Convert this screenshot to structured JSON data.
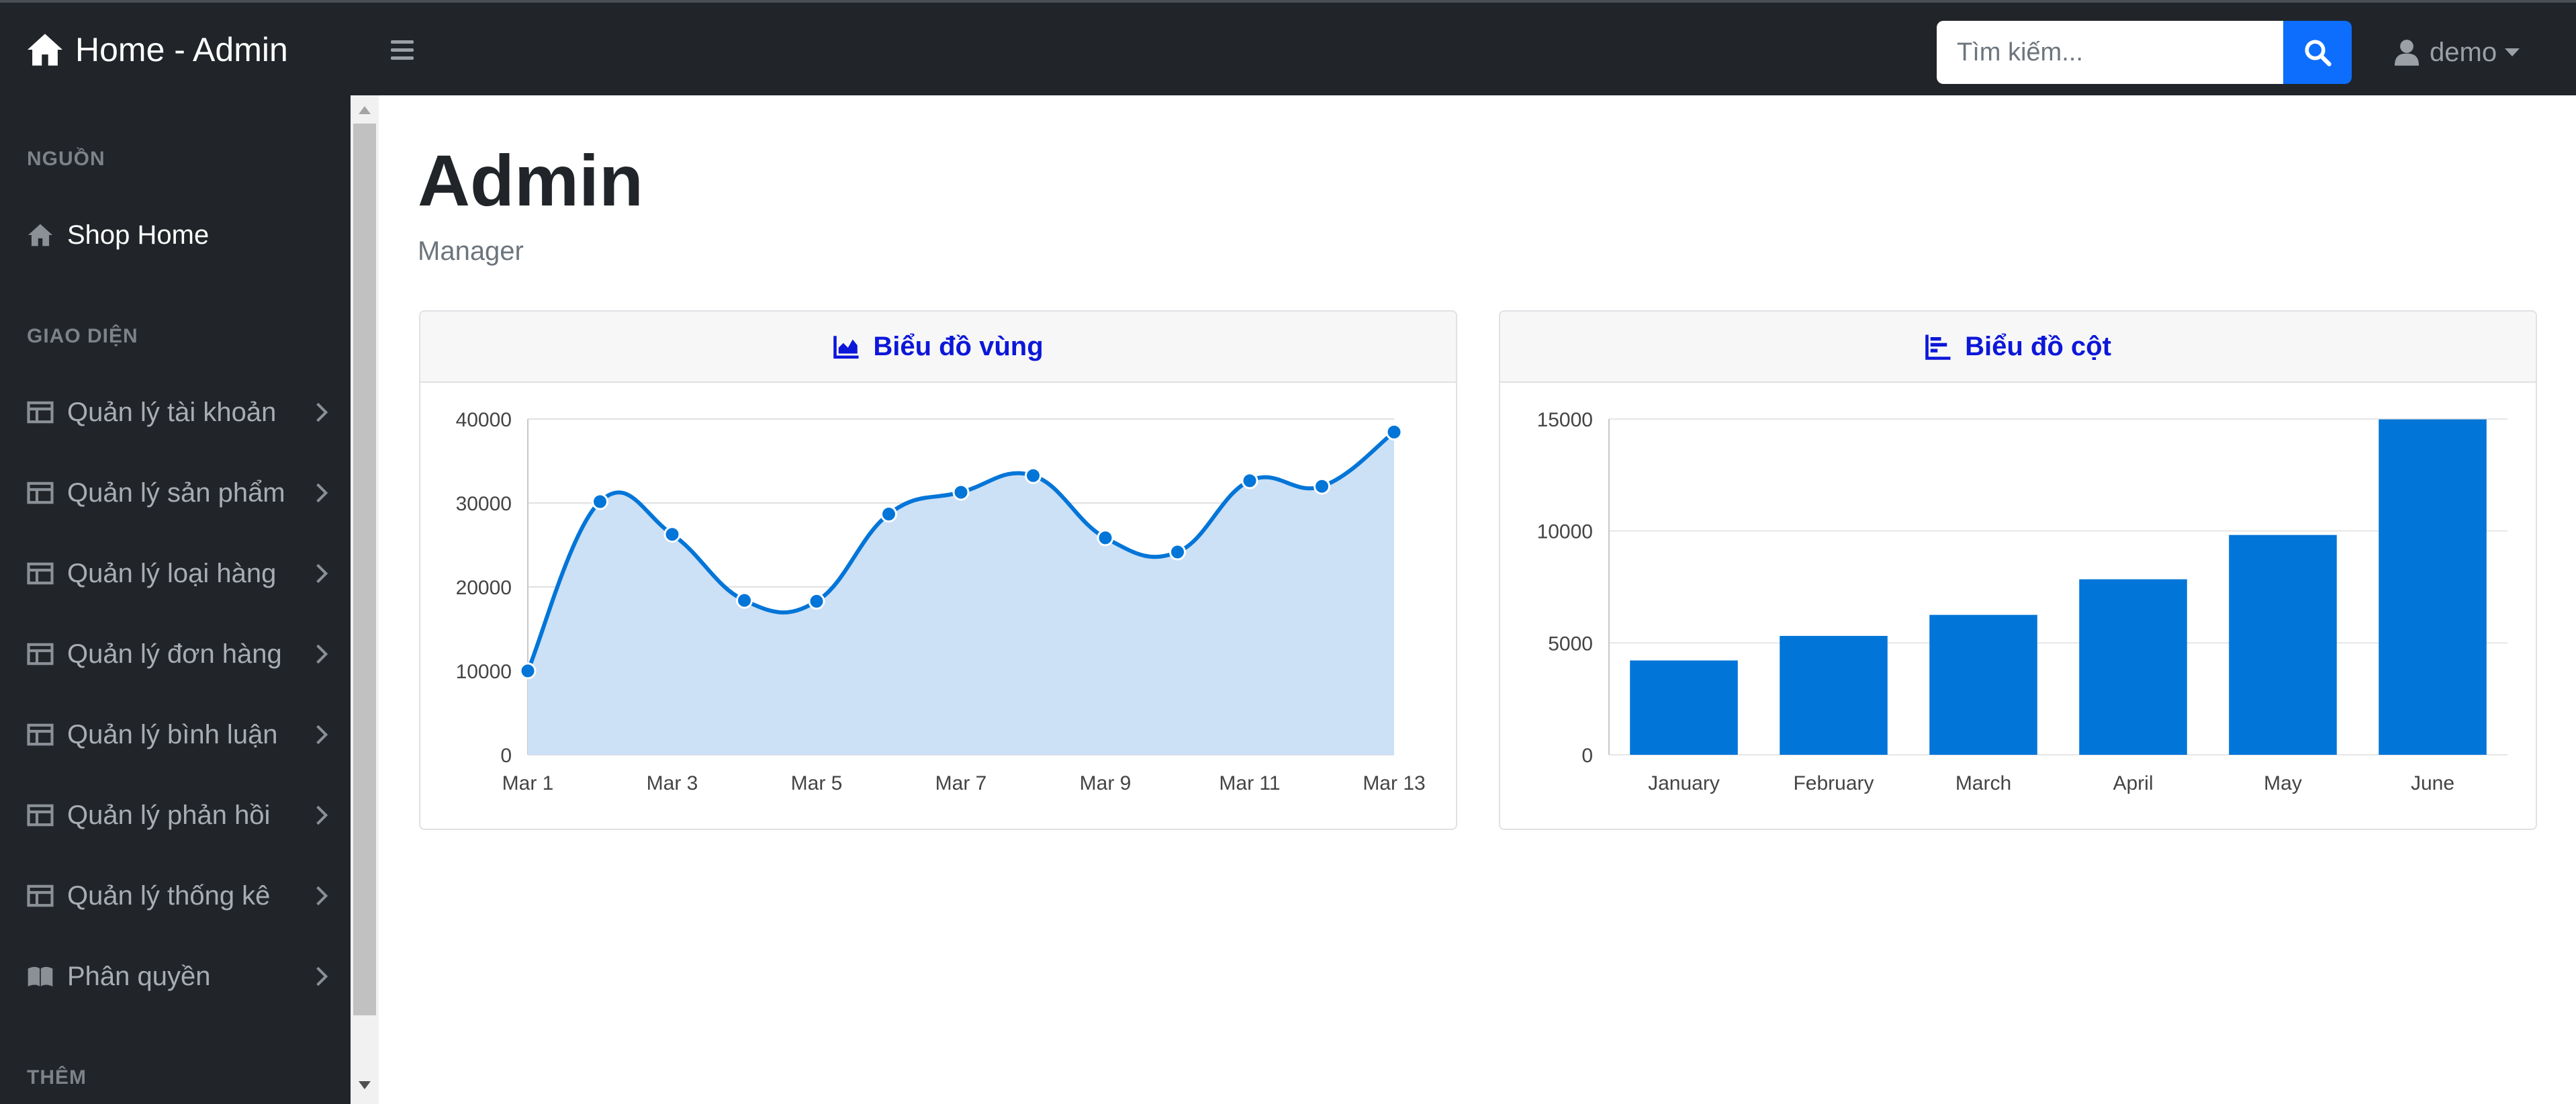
{
  "app": {
    "brand_title": "Home - Admin"
  },
  "search": {
    "placeholder": "Tìm kiếm..."
  },
  "user": {
    "name": "demo"
  },
  "sidebar": {
    "sections": [
      {
        "heading": "NGUỒN"
      },
      {
        "heading": "GIAO DIỆN"
      },
      {
        "heading": "THÊM"
      }
    ],
    "items": [
      {
        "label": "Shop Home",
        "icon": "home-icon"
      },
      {
        "label": "Quản lý tài khoản",
        "icon": "table-icon"
      },
      {
        "label": "Quản lý sản phẩm",
        "icon": "table-icon"
      },
      {
        "label": "Quản lý loại hàng",
        "icon": "table-icon"
      },
      {
        "label": "Quản lý đơn hàng",
        "icon": "table-icon"
      },
      {
        "label": "Quản lý bình luận",
        "icon": "table-icon"
      },
      {
        "label": "Quản lý phản hồi",
        "icon": "table-icon"
      },
      {
        "label": "Quản lý thống kê",
        "icon": "table-icon"
      },
      {
        "label": "Phân quyền",
        "icon": "book-icon"
      }
    ]
  },
  "main": {
    "title": "Admin",
    "subtitle": "Manager"
  },
  "colors": {
    "accent": "#0275d8",
    "area_fill": "#cce0f6",
    "header_text": "#0c17d9",
    "sidebar_bg": "#212529"
  },
  "cards": [
    {
      "title": "Biểu đồ vùng",
      "icon": "area-chart-icon"
    },
    {
      "title": "Biểu đồ cột",
      "icon": "bar-chart-icon"
    }
  ],
  "chart_data": [
    {
      "type": "area",
      "x": [
        "Mar 1",
        "Mar 2",
        "Mar 3",
        "Mar 4",
        "Mar 5",
        "Mar 6",
        "Mar 7",
        "Mar 8",
        "Mar 9",
        "Mar 10",
        "Mar 11",
        "Mar 12",
        "Mar 13"
      ],
      "tick_labels": [
        "Mar 1",
        "Mar 3",
        "Mar 5",
        "Mar 7",
        "Mar 9",
        "Mar 11",
        "Mar 13"
      ],
      "values": [
        10000,
        30162,
        26263,
        18394,
        18287,
        28682,
        31274,
        33259,
        25849,
        24159,
        32651,
        31984,
        38451
      ],
      "ylim": [
        0,
        40000
      ],
      "yticks": [
        0,
        10000,
        20000,
        30000,
        40000
      ],
      "grid": true
    },
    {
      "type": "bar",
      "categories": [
        "January",
        "February",
        "March",
        "April",
        "May",
        "June"
      ],
      "values": [
        4215,
        5312,
        6251,
        7841,
        9821,
        14984
      ],
      "ylim": [
        0,
        15000
      ],
      "yticks": [
        0,
        5000,
        10000,
        15000
      ],
      "grid": true
    }
  ]
}
